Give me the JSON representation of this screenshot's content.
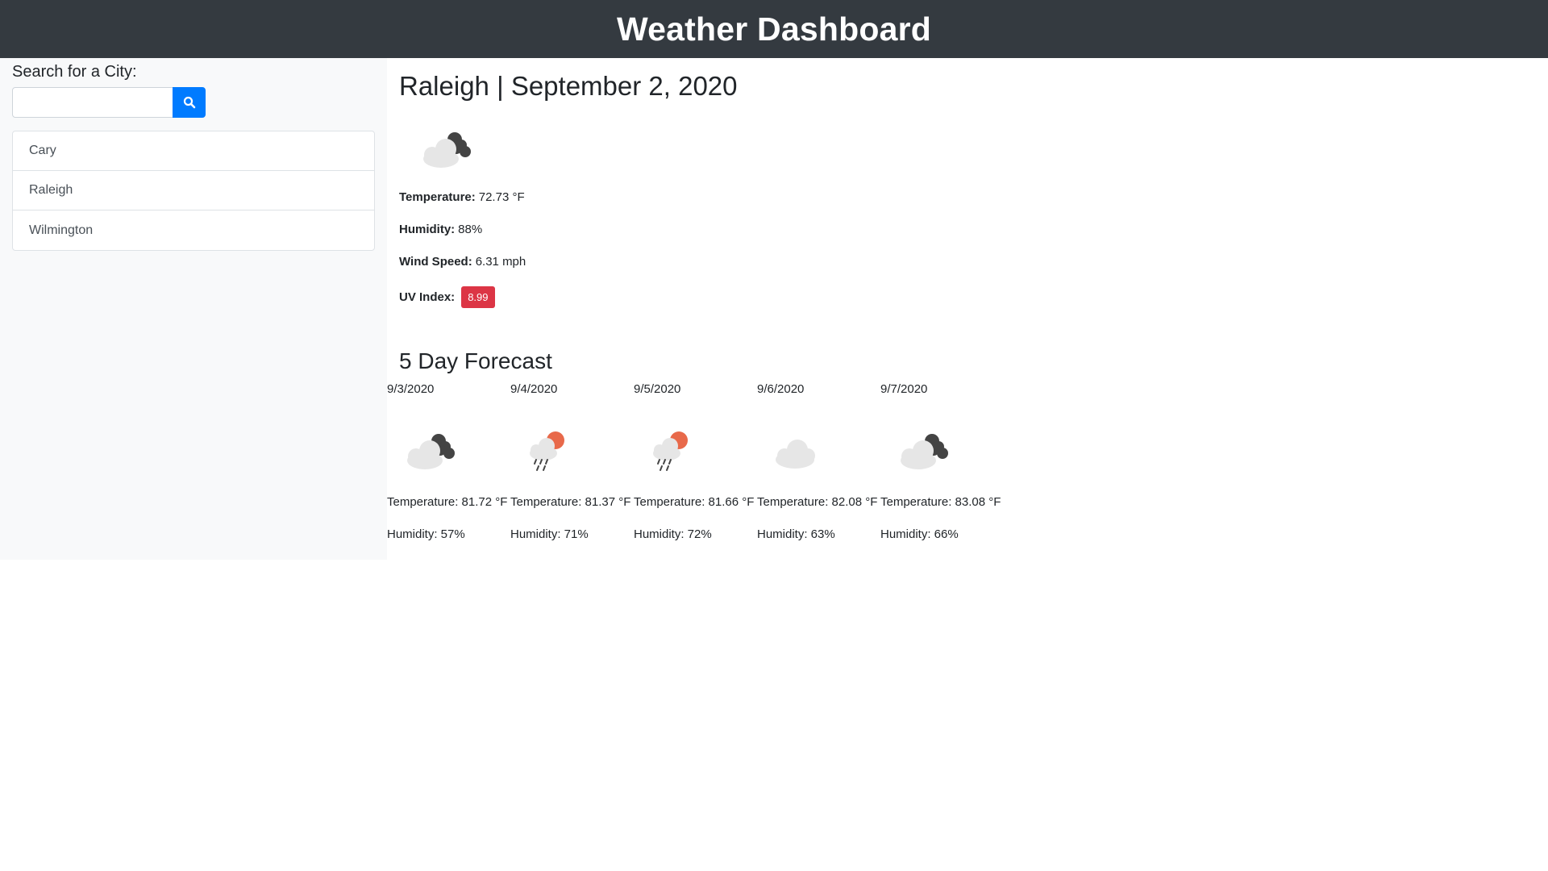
{
  "header": {
    "title": "Weather Dashboard"
  },
  "sidebar": {
    "search_label": "Search for a City:",
    "search_placeholder": "",
    "search_icon": "search-icon",
    "cities": [
      {
        "label": "Cary"
      },
      {
        "label": "Raleigh"
      },
      {
        "label": "Wilmington"
      }
    ]
  },
  "current": {
    "title": "Raleigh | September 2, 2020",
    "icon": "partly-cloudy-night-icon",
    "temperature_label": "Temperature:",
    "temperature_value": "72.73 °F",
    "humidity_label": "Humidity:",
    "humidity_value": "88%",
    "wind_label": "Wind Speed:",
    "wind_value": "6.31 mph",
    "uv_label": "UV Index:",
    "uv_value": "8.99"
  },
  "forecast": {
    "title": "5 Day Forecast",
    "days": [
      {
        "date": "9/3/2020",
        "icon": "partly-cloudy-night-icon",
        "temp": "Temperature: 81.72 °F",
        "humidity": "Humidity: 57%"
      },
      {
        "date": "9/4/2020",
        "icon": "rain-sun-icon",
        "temp": "Temperature: 81.37 °F",
        "humidity": "Humidity: 71%"
      },
      {
        "date": "9/5/2020",
        "icon": "rain-sun-icon",
        "temp": "Temperature: 81.66 °F",
        "humidity": "Humidity: 72%"
      },
      {
        "date": "9/6/2020",
        "icon": "cloud-icon",
        "temp": "Temperature: 82.08 °F",
        "humidity": "Humidity: 63%"
      },
      {
        "date": "9/7/2020",
        "icon": "partly-cloudy-night-icon",
        "temp": "Temperature: 83.08 °F",
        "humidity": "Humidity: 66%"
      }
    ]
  },
  "colors": {
    "header_bg": "#343a40",
    "accent": "#007bff",
    "uv_badge": "#dc3545",
    "sidebar_bg": "#f8f9fa"
  }
}
